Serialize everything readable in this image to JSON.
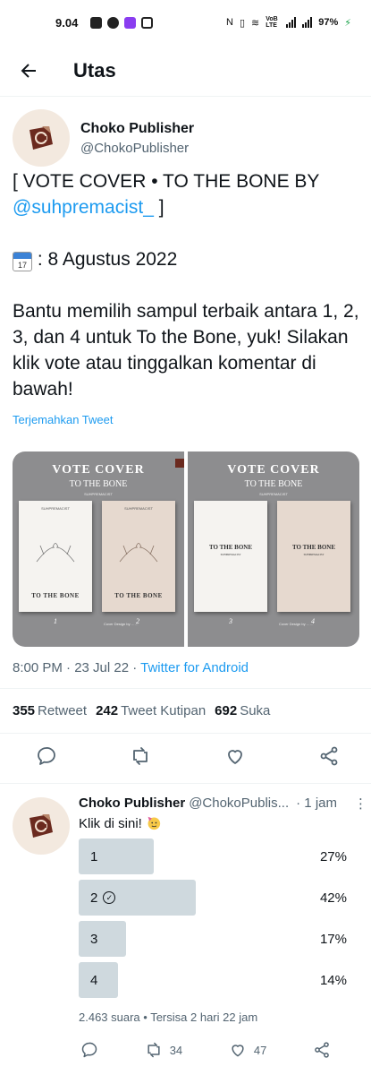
{
  "status_bar": {
    "time": "9.04",
    "battery": "97%",
    "network_label": "VoB LTE"
  },
  "header": {
    "title": "Utas"
  },
  "tweet": {
    "author_name": "Choko Publisher",
    "author_handle": "@ChokoPublisher",
    "line1": "[ VOTE COVER • TO THE BONE BY",
    "mention": "@suhpremacist_",
    "line1_end": " ]",
    "calendar_icon_text": "17",
    "date_line": " : 8 Agustus 2022",
    "body": "Bantu memilih sampul terbaik antara 1, 2, 3, dan 4 untuk To the Bone, yuk! Silakan klik vote atau tinggalkan komentar di bawah!",
    "translate": "Terjemahkan Tweet",
    "time": "8:00 PM · 23 Jul 22 · ",
    "source": "Twitter for Android",
    "stats": {
      "retweets": "355",
      "retweets_label": "Retweet",
      "quotes": "242",
      "quotes_label": "Tweet Kutipan",
      "likes": "692",
      "likes_label": "Suka"
    }
  },
  "media": {
    "panel_title": "VOTE COVER",
    "panel_subtitle": "TO THE BONE",
    "panel_meta": "SUHPREMACIST",
    "book_title": "TO THE BONE",
    "book_top_text": "SUHPREMACIST",
    "book_subtitle": "SUHPREMACIST",
    "credit": "Cover Design by ……",
    "numbers": [
      "1",
      "2",
      "3",
      "4"
    ]
  },
  "reply": {
    "author_name": "Choko Publisher",
    "author_handle": "@ChokoPublis...",
    "time": "· 1 jam",
    "text": "Klik di sini!",
    "poll": [
      {
        "label": "1",
        "percent": "27%",
        "fraction": 0.27,
        "selected": false
      },
      {
        "label": "2",
        "percent": "42%",
        "fraction": 0.42,
        "selected": true
      },
      {
        "label": "3",
        "percent": "17%",
        "fraction": 0.17,
        "selected": false
      },
      {
        "label": "4",
        "percent": "14%",
        "fraction": 0.14,
        "selected": false
      }
    ],
    "votes_line": "2.463 suara • Tersisa 2 hari 22 jam",
    "retweets": "34",
    "likes": "47"
  },
  "colors": {
    "link": "#1d9bf0",
    "secondary": "#536471",
    "poll_fill": "#cfd9de"
  }
}
